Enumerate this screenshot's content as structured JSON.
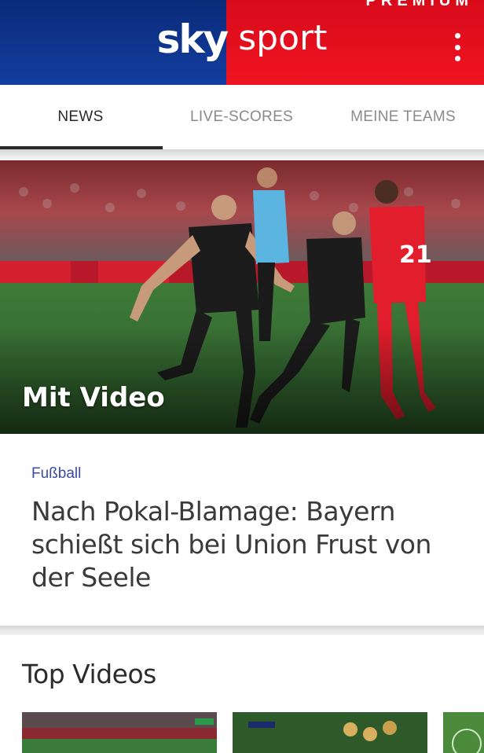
{
  "header": {
    "brand_sky": "sky",
    "brand_sport": "sport",
    "top_peek": "PREMIUM",
    "menu_icon": "more-vertical-icon",
    "colors": {
      "left": "#0a2b78",
      "right": "#e3101e"
    }
  },
  "tabs": [
    {
      "label": "NEWS",
      "active": true
    },
    {
      "label": "LIVE-SCORES",
      "active": false
    },
    {
      "label": "MEINE TEAMS",
      "active": false
    }
  ],
  "hero": {
    "badge": "Mit Video",
    "image": "football-celebration-photo"
  },
  "article": {
    "category": "Fußball",
    "headline": "Nach Pokal-Blamage: Bayern schießt sich bei Union Frust von der Seele"
  },
  "top_videos": {
    "title": "Top Videos",
    "thumbnails": [
      "football-pitch-thumbnail",
      "players-thumbnail",
      "pitch-thumbnail"
    ]
  }
}
